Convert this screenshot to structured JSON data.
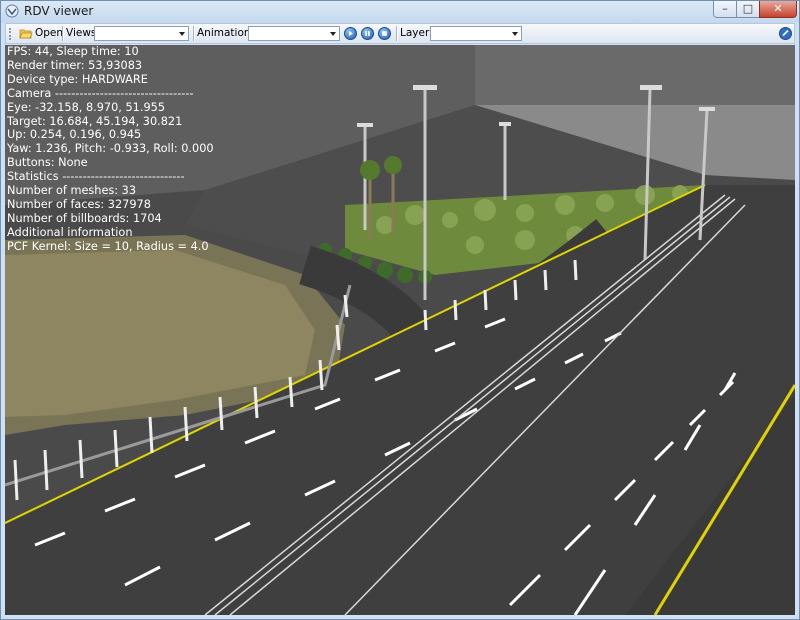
{
  "window": {
    "title": "RDV viewer",
    "minimize_glyph": "–",
    "maximize_glyph": "□",
    "close_glyph": "✕"
  },
  "toolbar": {
    "open_label": "Open",
    "views_label": "Views:",
    "views_value": "",
    "animations_label": "Animations:",
    "animations_value": "",
    "layers_label": "Layers:",
    "layers_value": ""
  },
  "overlay": {
    "lines": [
      "FPS: 44, Sleep time: 10",
      "Render timer: 53,93083",
      "Device type: HARDWARE",
      "Camera ----------------------------------",
      "Eye: -32.158, 8.970, 51.955",
      "Target: 16.684, 45.194, 30.821",
      "Up: 0.254, 0.196, 0.945",
      "Yaw: 1.236, Pitch: -0.933, Roll: 0.000",
      "Buttons: None",
      "Statistics ------------------------------",
      "Number of meshes: 33",
      "Number of faces: 327978",
      "Number of billboards: 1704",
      "Additional information",
      "PCF Kernel: Size = 10, Radius = 4.0"
    ]
  },
  "colors": {
    "road": "#3f3f3f",
    "lane_marking": "#ffffff",
    "edge_line": "#e0d400",
    "sky": "#8a8a8a",
    "vegetation": "#6e8a3c"
  }
}
